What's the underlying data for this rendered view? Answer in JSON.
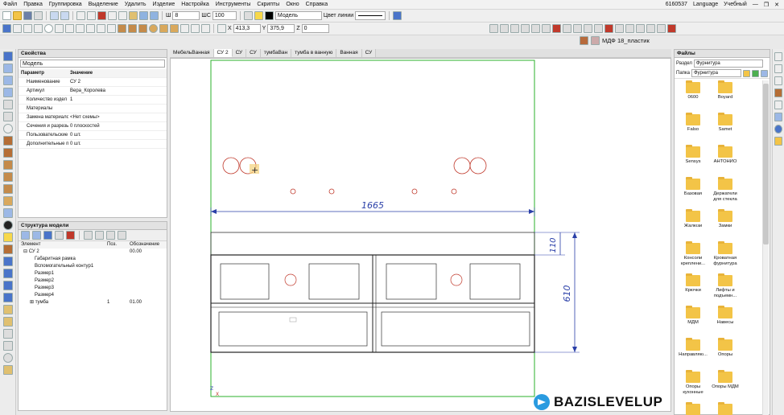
{
  "menu": [
    "Файл",
    "Правка",
    "Группировка",
    "Выделение",
    "Удалить",
    "Изделие",
    "Настройка",
    "Инструменты",
    "Скрипты",
    "Окно",
    "Справка"
  ],
  "status": {
    "code": "6160537",
    "language": "Language",
    "mode": "Учебный"
  },
  "toolbar1": {
    "layer": "8",
    "step_label": "ШС",
    "step": "100",
    "model_label": "Модель",
    "line_color_label": "Цвет линии"
  },
  "toolbar2": {
    "x_label": "X",
    "x": "413,3",
    "y_label": "Y",
    "y": "375,9",
    "z_label": "Z",
    "z": "0",
    "material": "МДФ 18_пластик"
  },
  "properties": {
    "title": "Свойства",
    "selector": "Модель",
    "col_param": "Параметр",
    "col_value": "Значение",
    "rows": [
      {
        "p": "Наименование",
        "v": "СУ 2"
      },
      {
        "p": "Артикул",
        "v": "Вера_Королева"
      },
      {
        "p": "Количество издел",
        "v": "1"
      },
      {
        "p": "Материалы",
        "v": ""
      },
      {
        "p": "Замена материало",
        "v": "<Нет схемы>"
      },
      {
        "p": "Сечения и разрезы",
        "v": "0 плоскостей"
      },
      {
        "p": "Пользовательские",
        "v": "0 шт."
      },
      {
        "p": "Дополнительные п",
        "v": "0 шт."
      }
    ]
  },
  "model_tree": {
    "title": "Структура модели",
    "col_element": "Элемент",
    "col_pos": "Поз.",
    "col_designation": "Обозначение",
    "root": {
      "name": "СУ 2",
      "designation": "00.00"
    },
    "items": [
      {
        "name": "Габаритная рамка",
        "pos": "",
        "des": ""
      },
      {
        "name": "Вспомогательный контур1",
        "pos": "",
        "des": ""
      },
      {
        "name": "Размер1",
        "pos": "",
        "des": ""
      },
      {
        "name": "Размер2",
        "pos": "",
        "des": ""
      },
      {
        "name": "Размер3",
        "pos": "",
        "des": ""
      },
      {
        "name": "Размер4",
        "pos": "",
        "des": ""
      },
      {
        "name": "тумба",
        "pos": "1",
        "des": "01.00"
      }
    ]
  },
  "doc_tabs": [
    "МебельВанная",
    "СУ 2",
    "СУ",
    "СУ",
    "тумбаВан",
    "тумба в ванную",
    "Ванная",
    "СУ"
  ],
  "active_tab": 1,
  "drawing": {
    "dim_width": "1665",
    "dim_top": "110",
    "dim_height": "610",
    "axis_y": "Y",
    "axis_z": "Z",
    "axis_x": "X"
  },
  "files": {
    "title": "Файлы",
    "section_label": "Раздел",
    "section": "Фурнитура",
    "folder_label": "Папка",
    "folder": "Фурнитура",
    "folders": [
      "0600",
      "Boyard",
      "Falso",
      "Samet",
      "Sensys",
      "АНТОНИО",
      "Базовая",
      "Держатели для стекла",
      "Жалюзи",
      "Замки",
      "Консоли креплени...",
      "Кроватная фурнитура",
      "Крючки",
      "Лифты и подъемн...",
      "МДМ",
      "Навесы",
      "Направляю...",
      "Опоры",
      "Опоры кухонные",
      "Опоры МДМ",
      "",
      ""
    ]
  },
  "watermark": "BAZISLEVELUP",
  "colors": {
    "accent": "#1f4fb3",
    "dimension": "#2a3fa8",
    "hole": "#c0392b",
    "frame": "#2bb02b"
  }
}
